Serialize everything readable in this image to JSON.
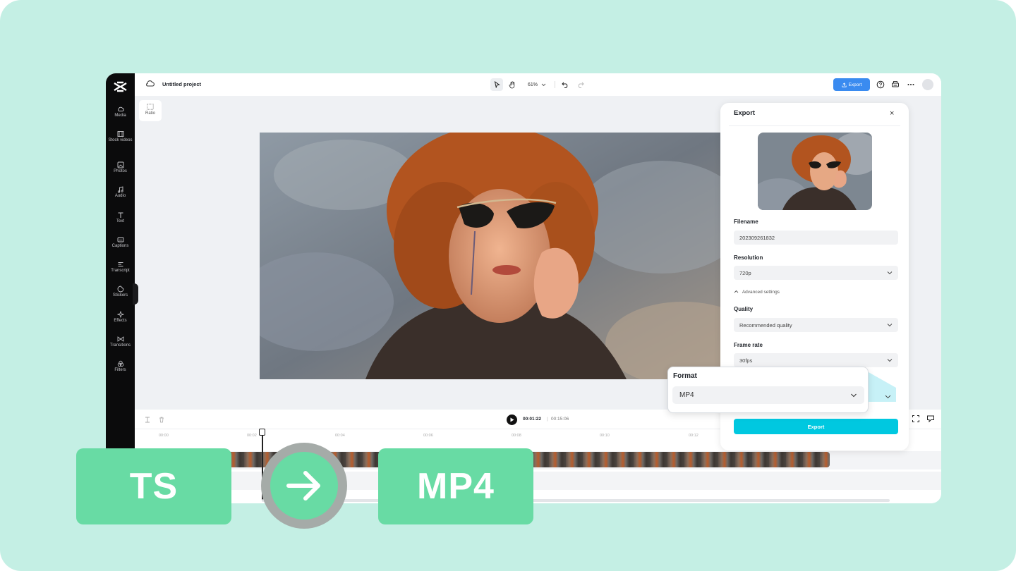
{
  "app": {
    "project_title": "Untitled project",
    "zoom": "61%",
    "export_button": "Export"
  },
  "sidebar": {
    "items": [
      {
        "label": "Media",
        "icon": "cloud-upload-icon"
      },
      {
        "label": "Stock videos",
        "icon": "film-icon"
      },
      {
        "label": "Photos",
        "icon": "image-icon"
      },
      {
        "label": "Audio",
        "icon": "music-note-icon"
      },
      {
        "label": "Text",
        "icon": "text-icon"
      },
      {
        "label": "Captions",
        "icon": "captions-icon"
      },
      {
        "label": "Transcript",
        "icon": "transcript-icon"
      },
      {
        "label": "Stickers",
        "icon": "sticker-icon"
      },
      {
        "label": "Effects",
        "icon": "sparkle-icon"
      },
      {
        "label": "Transitions",
        "icon": "transition-icon"
      },
      {
        "label": "Filters",
        "icon": "filter-icon"
      }
    ]
  },
  "canvas": {
    "ratio_label": "Ratio"
  },
  "timeline": {
    "current_time": "00:01:22",
    "separator": "|",
    "total_time": "00:15:06",
    "ticks": [
      "00:00",
      "00:02",
      "00:04",
      "00:06",
      "00:08",
      "00:10",
      "00:12"
    ]
  },
  "export_panel": {
    "title": "Export",
    "close": "×",
    "filename_label": "Filename",
    "filename_value": "202309261832",
    "resolution_label": "Resolution",
    "resolution_value": "720p",
    "advanced_settings": "Advanced settings",
    "quality_label": "Quality",
    "quality_value": "Recommended quality",
    "frame_rate_label": "Frame rate",
    "frame_rate_value": "30fps",
    "export_button": "Export"
  },
  "format_popover": {
    "label": "Format",
    "value": "MP4"
  },
  "overlay": {
    "from_format": "TS",
    "to_format": "MP4"
  },
  "colors": {
    "background": "#c4efe4",
    "badge": "#68dba4",
    "export_accent": "#00c8e0",
    "top_export": "#3a8bf0"
  }
}
